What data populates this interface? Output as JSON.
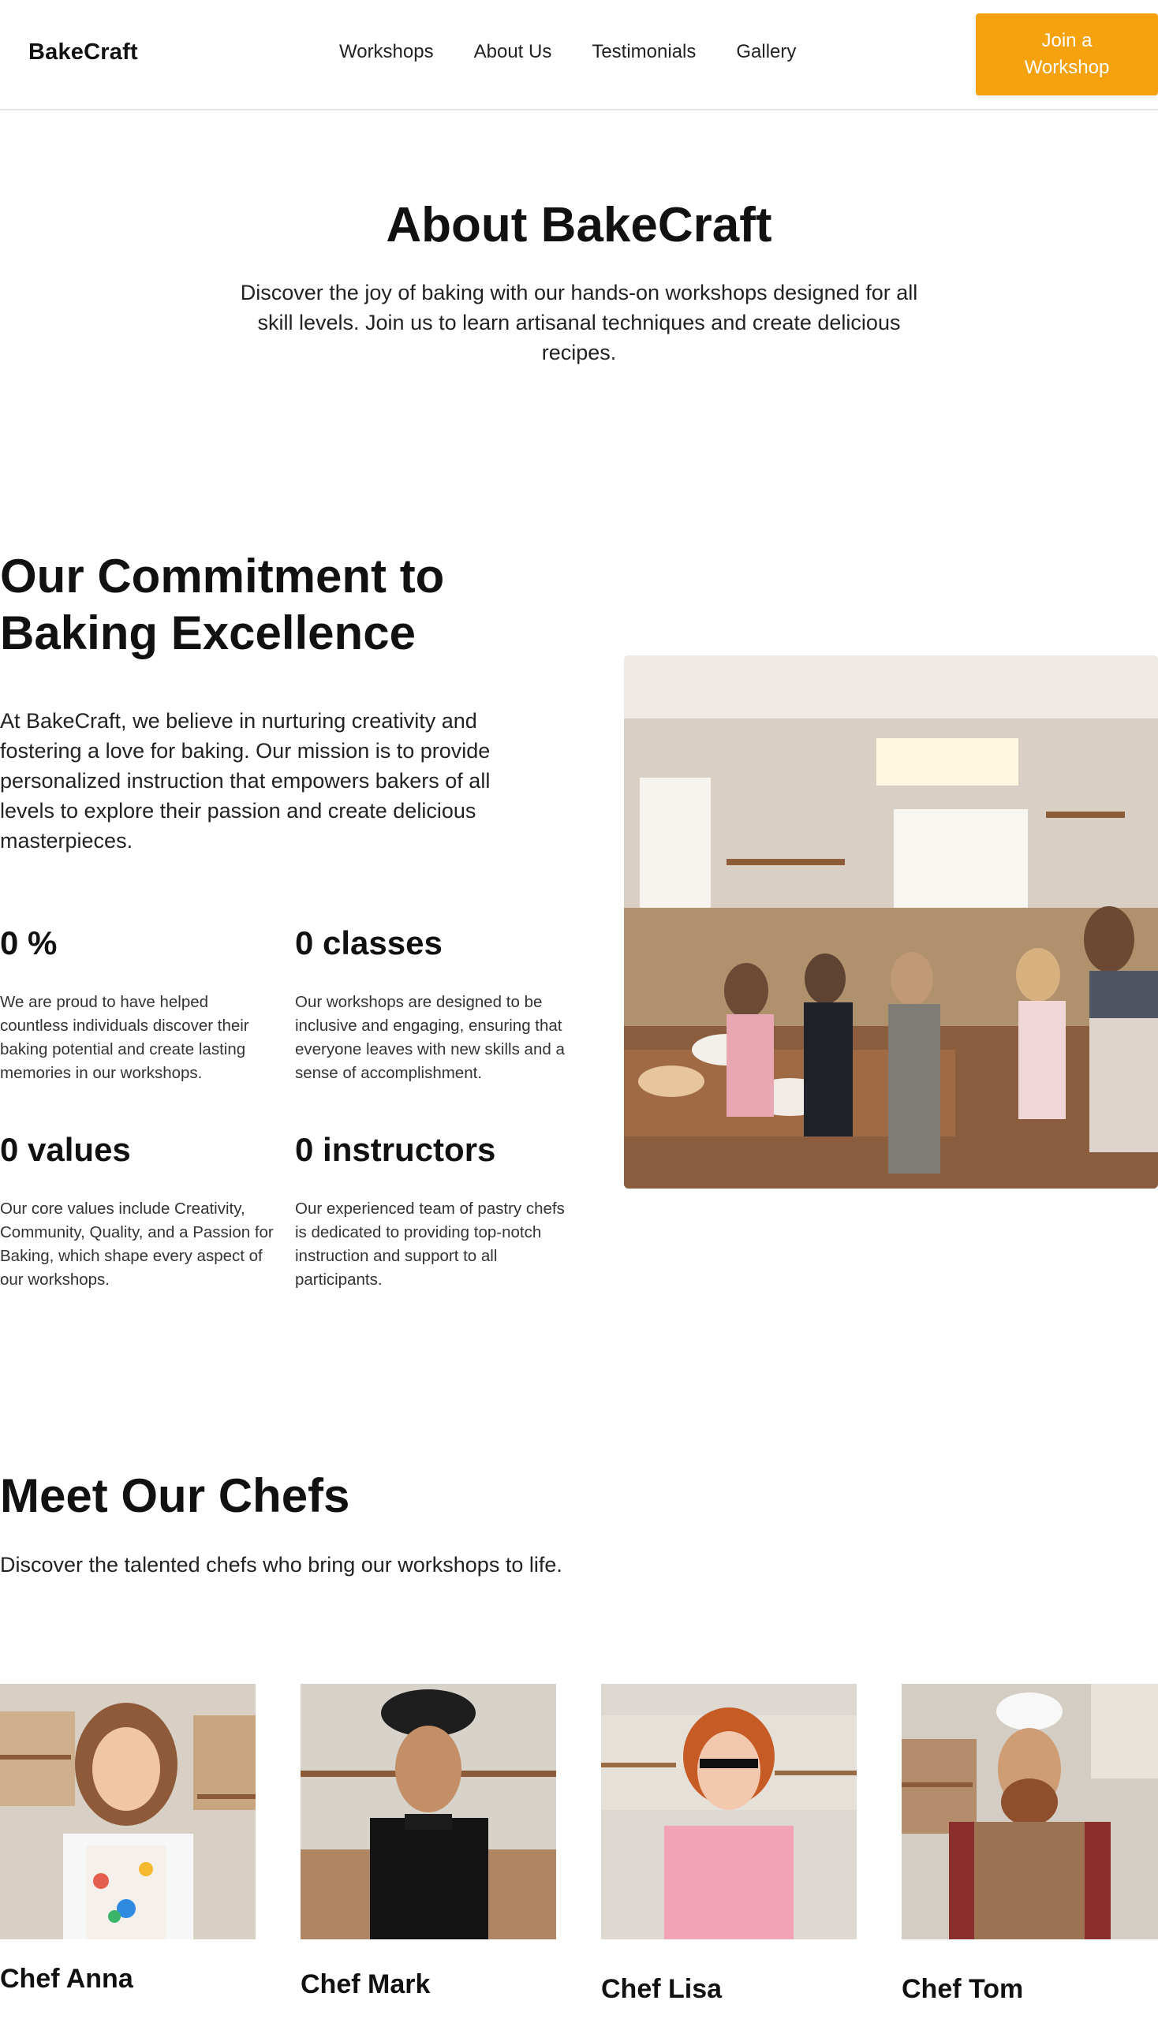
{
  "header": {
    "logo": "BakeCraft",
    "nav": [
      "Workshops",
      "About Us",
      "Testimonials",
      "Gallery"
    ],
    "cta_line1": "Join a",
    "cta_line2": "Workshop"
  },
  "about": {
    "title": "About BakeCraft",
    "text": "Discover the joy of baking with our hands-on workshops designed for all skill levels. Join us to learn artisanal techniques and create delicious recipes."
  },
  "commitment": {
    "title": "Our Commitment to Baking Excellence",
    "text": "At BakeCraft, we believe in nurturing creativity and fostering a love for baking. Our mission is to provide personalized instruction that empowers bakers of all levels to explore their passion and create delicious masterpieces.",
    "stats": [
      {
        "title": "0 %",
        "desc": "We are proud to have helped countless individuals discover their baking potential and create lasting memories in our workshops."
      },
      {
        "title": "0 classes",
        "desc": "Our workshops are designed to be inclusive and engaging, ensuring that everyone leaves with new skills and a sense of accomplishment."
      },
      {
        "title": "0 values",
        "desc": "Our core values include Creativity, Community, Quality, and a Passion for Baking, which shape every aspect of our workshops."
      },
      {
        "title": "0 instructors",
        "desc": "Our experienced team of pastry chefs is dedicated to providing top-notch instruction and support to all participants."
      }
    ]
  },
  "chefs": {
    "title": "Meet Our Chefs",
    "subtitle": "Discover the talented chefs who bring our workshops to life.",
    "items": [
      {
        "name": "Chef Anna"
      },
      {
        "name": "Chef Mark"
      },
      {
        "name": "Chef Lisa"
      },
      {
        "name": "Chef Tom"
      }
    ]
  },
  "colors": {
    "accent": "#f5a20e",
    "text": "#111111",
    "divider": "#e6e6e6"
  }
}
